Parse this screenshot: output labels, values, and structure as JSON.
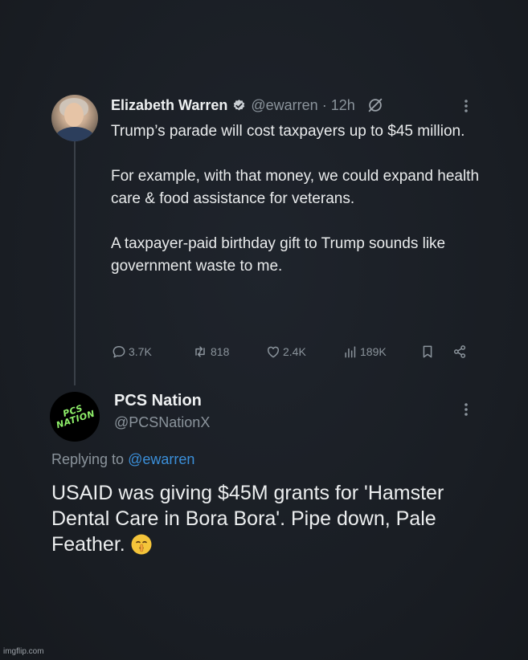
{
  "tweet": {
    "author_name": "Elizabeth Warren",
    "author_handle": "@ewarren",
    "separator": "·",
    "time": "12h",
    "paragraphs": [
      "Trump’s parade will cost taxpayers up to $45 million.",
      "For example, with that money, we could expand health care & food assistance for veterans.",
      "A taxpayer-paid birthday gift to Trump sounds like government waste to me."
    ],
    "stats": {
      "replies": "3.7K",
      "retweets": "818",
      "likes": "2.4K",
      "views": "189K"
    }
  },
  "reply": {
    "author_name": "PCS Nation",
    "author_handle": "@PCSNationX",
    "avatar_logo_line1": "PCS",
    "avatar_logo_line2": "NATION",
    "replying_prefix": "Replying to",
    "replying_mention": "@ewarren",
    "text": "USAID was giving $45M grants for 'Hamster Dental Care in Bora Bora'. Pipe down, Pale Feather.",
    "emoji": "shushing-face-emoji"
  },
  "watermark": "imgflip.com",
  "colors": {
    "background": "#1b1f26",
    "primary_text": "#e7e9ea",
    "secondary_text": "#8b949c",
    "link": "#3b8fd9",
    "verified": "#c9ced3",
    "logo_green": "#8ff06a"
  }
}
